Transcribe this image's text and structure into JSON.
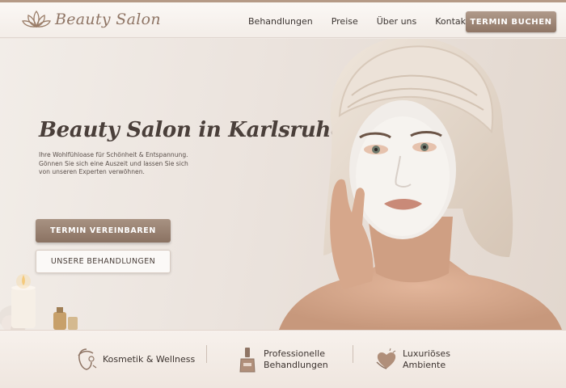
{
  "header": {
    "logo_text": "Beauty Salon",
    "nav": [
      {
        "label": "Behandlungen"
      },
      {
        "label": "Preise"
      },
      {
        "label": "Über uns"
      },
      {
        "label": "Kontakt"
      }
    ],
    "cta_label": "TERMIN BUCHEN"
  },
  "hero": {
    "title": "Beauty Salon in Karlsruhe!",
    "lines": [
      "Ihre Wohlfühloase für Schönheit & Entspannung.",
      "Gönnen Sie sich eine Auszeit und lassen Sie sich",
      "von unseren Experten verwöhnen."
    ],
    "primary_button": "TERMIN VEREINBAREN",
    "secondary_button": "UNSERE BEHANDLUNGEN"
  },
  "features": [
    {
      "icon": "face-care-icon",
      "lines": [
        "Kosmetik & Wellness"
      ]
    },
    {
      "icon": "nail-polish-icon",
      "lines": [
        "Professionelle",
        "Behandlungen"
      ]
    },
    {
      "icon": "heart-hands-icon",
      "lines": [
        "Luxuriöses",
        "Ambiente"
      ]
    }
  ],
  "colors": {
    "accent": "#8f7565",
    "button": "#9c8474",
    "background": "#efe8e2"
  }
}
